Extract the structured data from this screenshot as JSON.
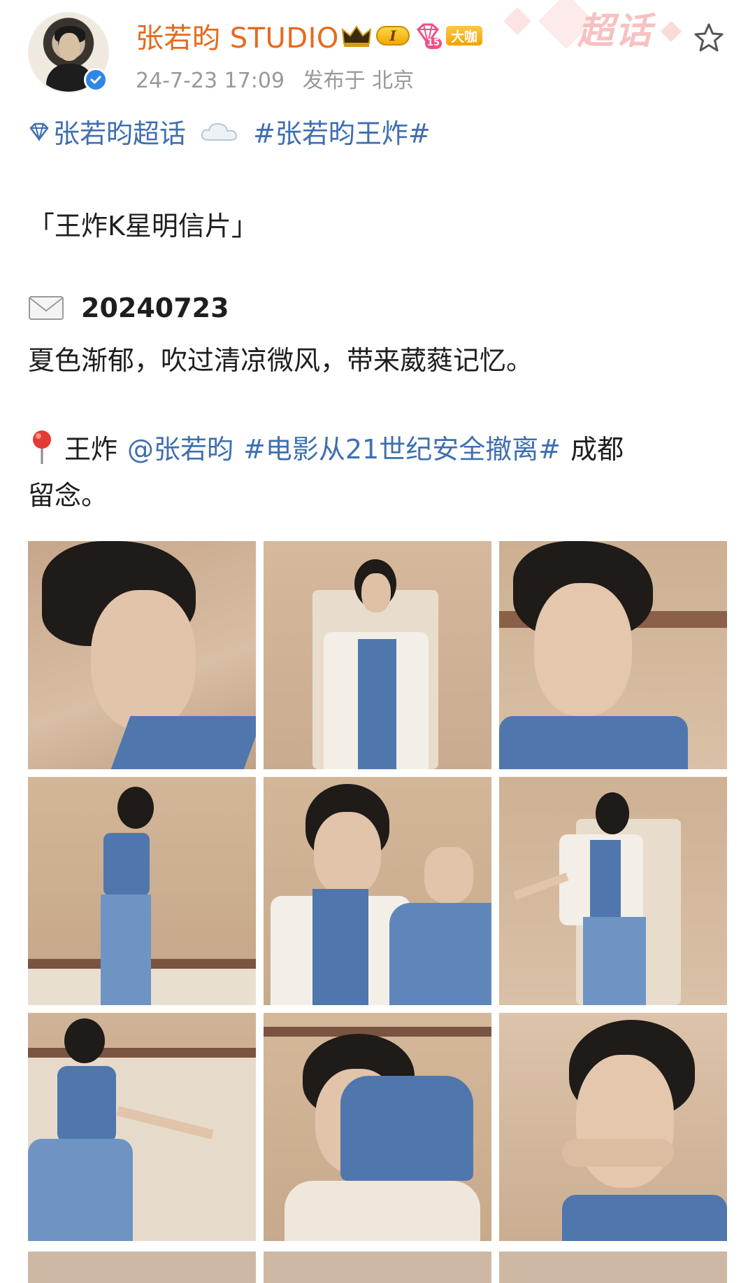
{
  "post": {
    "username": "张若昀 STUDIO",
    "level_badge": "I",
    "fan_level": "15",
    "big_badge": "大咖",
    "supertopic_watermark": "超话",
    "timestamp": "24-7-23 17:09",
    "location": "发布于 北京"
  },
  "content": {
    "supertopic_link": "张若昀超话",
    "hashtag_1": "#张若昀王炸#",
    "title": "「王炸K星明信片」",
    "date": "20240723",
    "line_1": "夏色渐郁，吹过清凉微风，带来葳蕤记忆。",
    "place_word": "王炸",
    "mention": "@张若昀",
    "hashtag_2": "#电影从21世纪安全撤离#",
    "tail_1": "成都",
    "tail_2": "留念。"
  },
  "photos": {
    "count": 9,
    "colors": {
      "wall": "#c9b096",
      "denim": "#4f77ad",
      "shirt": "#f2eee6",
      "hair": "#1c1a18"
    }
  },
  "icons": [
    "avatar",
    "verified-icon",
    "crown-icon",
    "gem-icon",
    "star-icon",
    "diamond-icon",
    "cloud-icon",
    "envelope-icon",
    "pin-icon"
  ]
}
